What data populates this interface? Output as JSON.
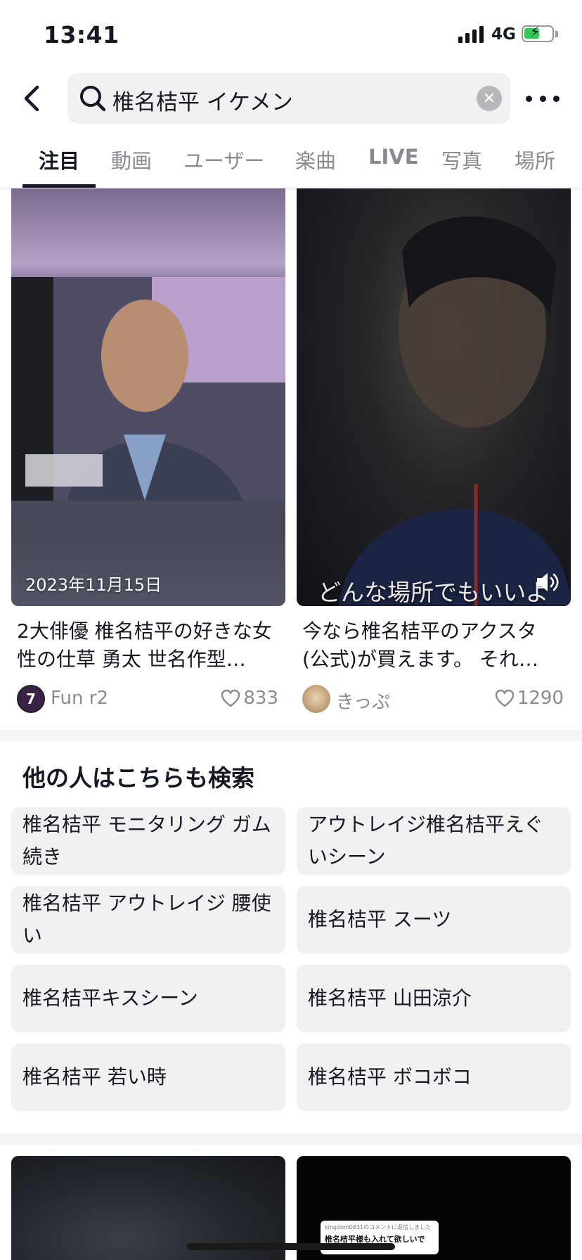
{
  "status_bar": {
    "time": "13:41",
    "network": "4G",
    "battery_level": 0.55
  },
  "search": {
    "query": "椎名桔平 イケメン"
  },
  "tabs": [
    {
      "label": "注目"
    },
    {
      "label": "動画"
    },
    {
      "label": "ユーザー"
    },
    {
      "label": "楽曲"
    },
    {
      "label": "LIVE"
    },
    {
      "label": "写真"
    },
    {
      "label": "場所"
    }
  ],
  "active_tab": "注目",
  "videos": [
    {
      "overlay_date": "2023年11月15日",
      "title": "2大俳優 椎名桔平の好きな女性の仕草 勇太 世名作型…",
      "author": "Fun r2",
      "avatar_letter": "7",
      "likes": "833"
    },
    {
      "overlay_caption": "どんな場所でもいいよ",
      "title": "今なら椎名桔平のアクスタ(公式)が買えます。 それ…",
      "author": "きっぷ",
      "likes": "1290"
    }
  ],
  "related": {
    "title": "他の人はこちらも検索",
    "items": [
      "椎名桔平 モニタリング ガム続き",
      "アウトレイジ椎名桔平えぐいシーン",
      "椎名桔平 アウトレイジ 腰使い",
      "椎名桔平 スーツ",
      "椎名桔平キスシーン",
      "椎名桔平 山田涼介",
      "椎名桔平 若い時",
      "椎名桔平 ボコボコ"
    ]
  },
  "bottom_preview": {
    "comment_header": "kingdom0831のコメントに返信しました",
    "comment_text": "椎名桔平様も入れて欲しいで"
  }
}
